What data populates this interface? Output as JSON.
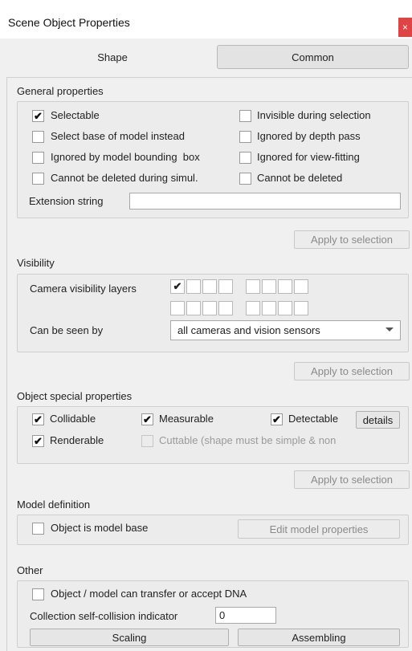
{
  "window": {
    "title": "Scene Object Properties",
    "close_glyph": "×"
  },
  "tabs": [
    {
      "label": "Shape",
      "active": false
    },
    {
      "label": "Common",
      "active": true
    }
  ],
  "general": {
    "header": "General properties",
    "items": [
      {
        "label": "Selectable",
        "checked": true
      },
      {
        "label": "Invisible during selection",
        "checked": false
      },
      {
        "label": "Select base of model instead",
        "checked": false
      },
      {
        "label": "Ignored by depth pass",
        "checked": false
      },
      {
        "label": "Ignored by model bounding  box",
        "checked": false
      },
      {
        "label": "Ignored for view-fitting",
        "checked": false
      },
      {
        "label": "Cannot be deleted during simul.",
        "checked": false
      },
      {
        "label": "Cannot be deleted",
        "checked": false
      }
    ],
    "extension_label": "Extension string",
    "extension_value": "",
    "apply_label": "Apply to selection"
  },
  "visibility": {
    "header": "Visibility",
    "layers_label": "Camera visibility layers",
    "layers": [
      true,
      false,
      false,
      false,
      false,
      false,
      false,
      false,
      false,
      false,
      false,
      false,
      false,
      false,
      false,
      false
    ],
    "seen_by_label": "Can be seen by",
    "seen_by_value": "all cameras and vision sensors",
    "apply_label": "Apply to selection"
  },
  "special": {
    "header": "Object special properties",
    "collidable": {
      "label": "Collidable",
      "checked": true
    },
    "measurable": {
      "label": "Measurable",
      "checked": true
    },
    "detectable": {
      "label": "Detectable",
      "checked": true
    },
    "details_label": "details",
    "renderable": {
      "label": "Renderable",
      "checked": true
    },
    "cuttable": {
      "label": "Cuttable (shape must be simple & non",
      "checked": false
    },
    "apply_label": "Apply to selection"
  },
  "model": {
    "header": "Model definition",
    "model_base": {
      "label": "Object is model base",
      "checked": false
    },
    "edit_label": "Edit model properties"
  },
  "other": {
    "header": "Other",
    "dna": {
      "label": "Object / model can transfer or accept DNA",
      "checked": false
    },
    "collision_label": "Collection self-collision indicator",
    "collision_value": "0",
    "scaling_label": "Scaling",
    "assembling_label": "Assembling"
  }
}
